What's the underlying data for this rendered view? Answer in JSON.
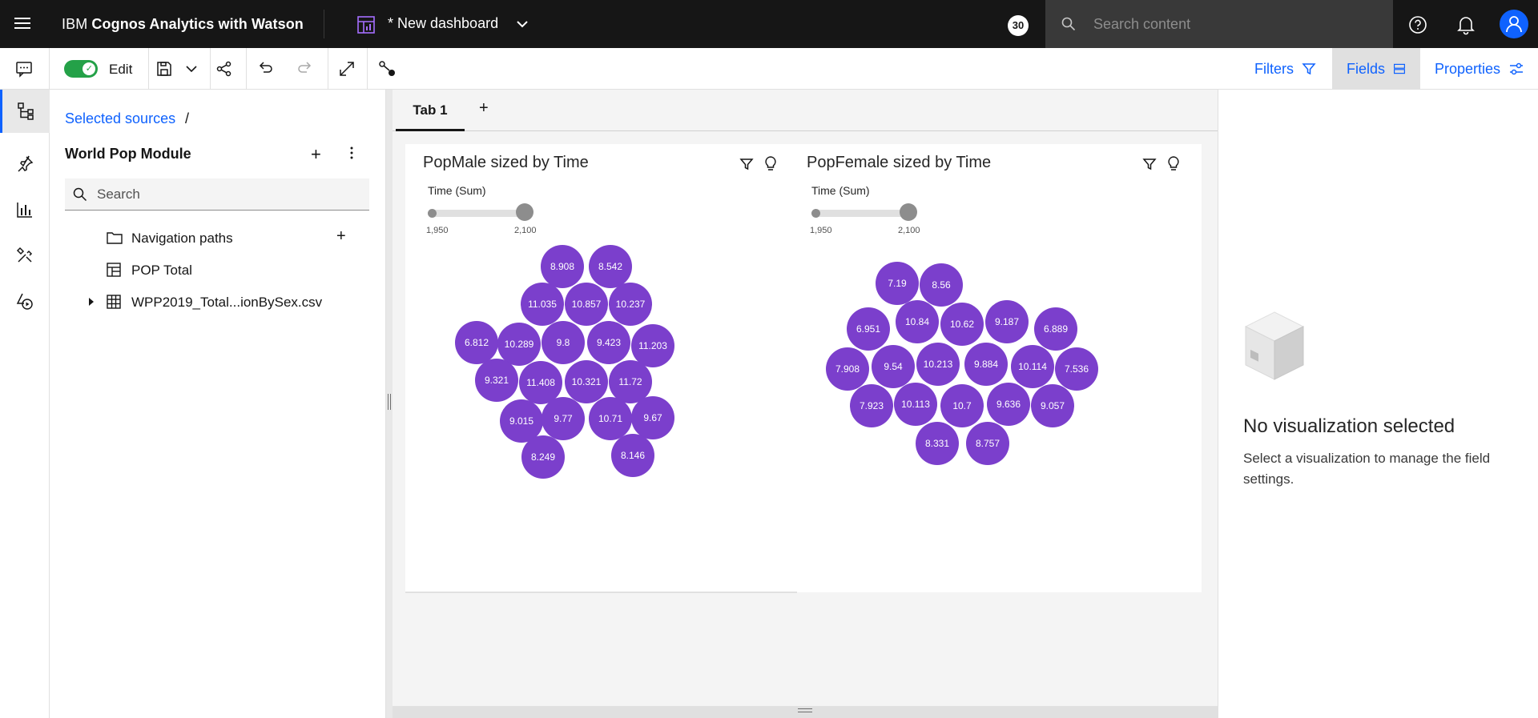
{
  "topbar": {
    "brand_prefix": "IBM ",
    "brand_name": "Cognos Analytics with Watson",
    "dashboard_title": "* New dashboard",
    "count_badge": "30",
    "search_placeholder": "Search content"
  },
  "toolbar": {
    "edit_label": "Edit",
    "filters_label": "Filters",
    "fields_label": "Fields",
    "properties_label": "Properties"
  },
  "sources": {
    "breadcrumb": "Selected sources",
    "breadcrumb_sep": "/",
    "module_title": "World Pop Module",
    "search_placeholder": "Search",
    "items": [
      {
        "label": "Navigation paths",
        "icon": "folder-icon"
      },
      {
        "label": "POP Total",
        "icon": "table-icon"
      },
      {
        "label": "WPP2019_Total...ionBySex.csv",
        "icon": "grid-icon"
      }
    ]
  },
  "canvas": {
    "tab_label": "Tab 1",
    "add_tab": "+"
  },
  "viz_male": {
    "title": "PopMale sized by Time",
    "slider_label": "Time (Sum)",
    "slider_min": "1,950",
    "slider_max": "2,100"
  },
  "viz_female": {
    "title": "PopFemale sized by Time",
    "slider_label": "Time (Sum)",
    "slider_min": "1,950",
    "slider_max": "2,100"
  },
  "chart_data": [
    {
      "type": "bubble",
      "title": "PopMale sized by Time",
      "color": "#7b3fcc",
      "labels": [
        "8.908",
        "8.542",
        "11.035",
        "10.857",
        "10.237",
        "6.812",
        "10.289",
        "9.8",
        "9.423",
        "11.203",
        "9.321",
        "11.408",
        "10.321",
        "11.72",
        "9.015",
        "9.77",
        "10.71",
        "9.67",
        "8.249",
        "8.146"
      ]
    },
    {
      "type": "bubble",
      "title": "PopFemale sized by Time",
      "color": "#7b3fcc",
      "labels": [
        "7.19",
        "8.56",
        "6.951",
        "10.84",
        "10.62",
        "9.187",
        "6.889",
        "7.908",
        "9.54",
        "10.213",
        "9.884",
        "10.114",
        "7.536",
        "7.923",
        "10.113",
        "10.7",
        "9.636",
        "9.057",
        "8.331",
        "8.757"
      ]
    }
  ],
  "right_panel": {
    "title": "No visualization selected",
    "description": "Select a visualization to manage the field settings."
  }
}
